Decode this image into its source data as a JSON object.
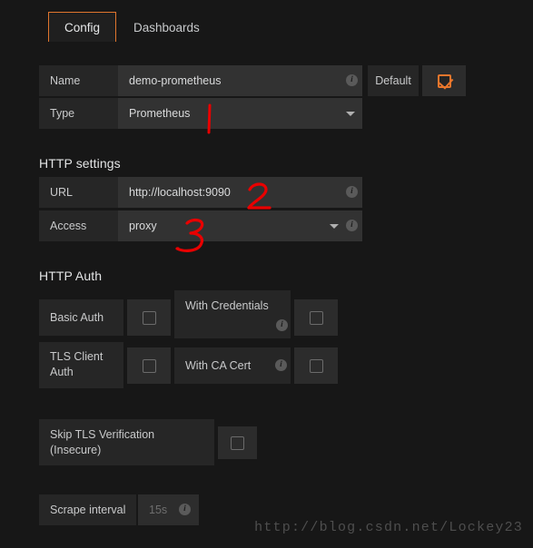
{
  "tabs": [
    {
      "label": "Config",
      "active": true
    },
    {
      "label": "Dashboards",
      "active": false
    }
  ],
  "datasource": {
    "name_label": "Name",
    "name_value": "demo-prometheus",
    "default_label": "Default",
    "default_checked": true,
    "type_label": "Type",
    "type_value": "Prometheus"
  },
  "http_settings": {
    "title": "HTTP settings",
    "url_label": "URL",
    "url_value": "http://localhost:9090",
    "access_label": "Access",
    "access_value": "proxy"
  },
  "http_auth": {
    "title": "HTTP Auth",
    "basic_auth_label": "Basic Auth",
    "basic_auth_checked": false,
    "with_credentials_label": "With Credentials",
    "with_credentials_checked": false,
    "tls_client_auth_label": "TLS Client Auth",
    "tls_client_auth_checked": false,
    "with_ca_cert_label": "With CA Cert",
    "with_ca_cert_checked": false,
    "skip_tls_label": "Skip TLS Verification (Insecure)",
    "skip_tls_checked": false
  },
  "scrape": {
    "label": "Scrape interval",
    "placeholder": "15s",
    "value": ""
  },
  "annotations": [
    {
      "marker": "1",
      "kind": "stroke"
    },
    {
      "marker": "2",
      "kind": "stroke"
    },
    {
      "marker": "3",
      "kind": "stroke"
    }
  ],
  "icons": {
    "info": "i",
    "caret_down": "chevron-down-icon"
  },
  "watermark": "http://blog.csdn.net/Lockey23",
  "colors": {
    "accent": "#e8762c",
    "page_bg": "#171717",
    "label_bg": "#262626",
    "field_bg": "#323232",
    "annotation": "#e80000"
  }
}
